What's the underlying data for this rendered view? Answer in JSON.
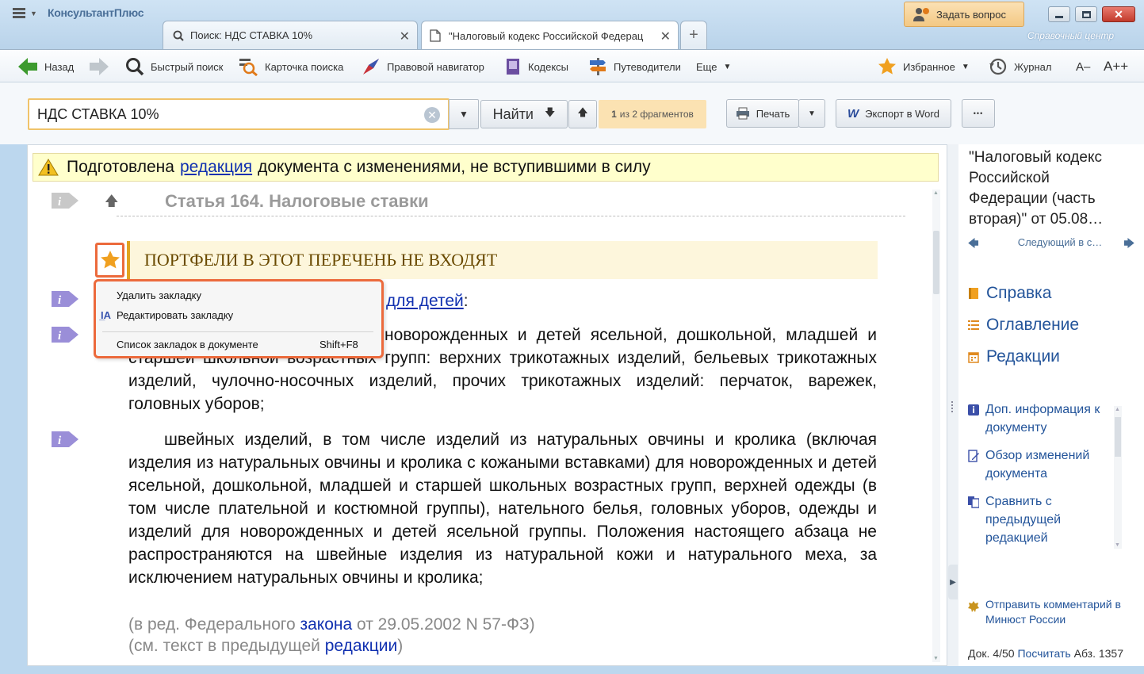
{
  "window": {
    "brand": "КонсультантПлюс",
    "tabs": [
      {
        "label": "Поиск: НДС СТАВКА 10%"
      },
      {
        "label": "\"Налоговый кодекс Российской Федерац"
      }
    ],
    "ask_button": "Задать вопрос",
    "logo_right": "Справочный центр"
  },
  "toolbar": {
    "back": "Назад",
    "quick_search": "Быстрый поиск",
    "search_card": "Карточка поиска",
    "legal_navigator": "Правовой навигатор",
    "codes": "Кодексы",
    "guides": "Путеводители",
    "more": "Еще",
    "favorites": "Избранное",
    "journal": "Журнал",
    "font_smaller": "A–",
    "font_larger": "A++"
  },
  "search": {
    "value": "НДС СТАВКА 10%",
    "find_button": "Найти",
    "fragments_count": "1",
    "fragments_label": "из 2 фрагментов",
    "print": "Печать",
    "export_word": "Экспорт в Word",
    "more_dots": "•••"
  },
  "document": {
    "warning_pre": "Подготовлена",
    "warning_link": "редакция",
    "warning_post": "документа с изменениями, не вступившими в силу",
    "article_title": "Статья 164. Налоговые ставки",
    "bookmark_text": "ПОРТФЕЛИ В ЭТОТ ПЕРЕЧЕНЬ НЕ ВХОДЯТ",
    "line1_link": "для детей",
    "line1_tail": ":",
    "para1": "трикотажных изделий для новорожденных и детей ясельной, дошкольной, младшей и старшей школьной возрастных групп: верхних трикотажных изделий, бельевых трикотажных изделий, чулочно-носочных изделий, прочих трикотажных изделий: перчаток, варежек, головных уборов;",
    "para2": "швейных изделий, в том числе изделий из натуральных овчины и кролика (включая изделия из натуральных овчины и кролика с кожаными вставками) для новорожденных и детей ясельной, дошкольной, младшей и старшей школьных возрастных групп, верхней одежды (в том числе плательной и костюмной группы), нательного белья, головных уборов, одежды и изделий для новорожденных и детей ясельной группы. Положения настоящего абзаца не распространяются на швейные изделия из натуральной кожи и натурального меха, за исключением натуральных овчины и кролика;",
    "note1_pre": "(в ред. Федерального",
    "note1_link": "закона",
    "note1_post": "от 29.05.2002 N 57-ФЗ)",
    "note2_pre": "(см. текст в предыдущей",
    "note2_link": "редакции",
    "note2_post": ")"
  },
  "context_menu": {
    "delete": "Удалить закладку",
    "edit": "Редактировать закладку",
    "list": "Список закладок в документе",
    "list_shortcut": "Shift+F8"
  },
  "right_pane": {
    "title": "\"Налоговый кодекс Российской Федерации (часть вторая)\" от 05.08…",
    "next_label": "Следующий в с…",
    "reference": "Справка",
    "contents": "Оглавление",
    "editions": "Редакции",
    "add_info": "Доп. информация к документу",
    "changes_review": "Обзор изменений документа",
    "compare": "Сравнить с предыдущей редакцией",
    "send_comment": "Отправить комментарий в Минюст России",
    "footer_doc": "Док. 4/50",
    "footer_count": "Посчитать",
    "footer_abz": "Абз. 1357"
  },
  "colors": {
    "accent_orange": "#ec6a3c",
    "link_blue": "#1030b0",
    "warning_bg": "#ffffcc"
  }
}
